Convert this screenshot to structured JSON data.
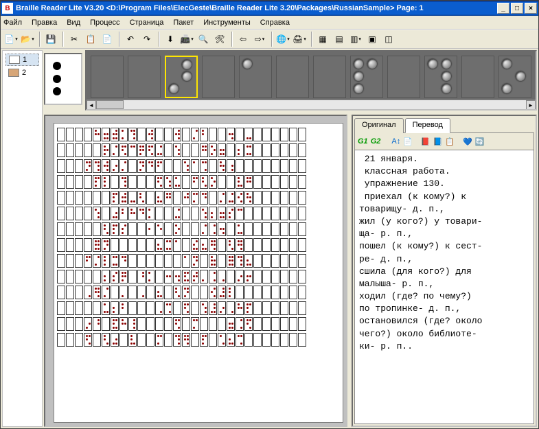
{
  "window": {
    "title": "Braille Reader Lite  V3.20  <D:\\Program Files\\ElecGeste\\Braille Reader Lite 3.20\\Packages\\RussianSample>  Page: 1",
    "min": "_",
    "max": "□",
    "close": "×"
  },
  "menu": [
    "Файл",
    "Правка",
    "Вид",
    "Процесс",
    "Страница",
    "Пакет",
    "Инструменты",
    "Справка"
  ],
  "left": {
    "items": [
      {
        "num": "1",
        "orange": false
      },
      {
        "num": "2",
        "orange": true
      }
    ]
  },
  "tabs": {
    "original": "Оригинал",
    "translation": "Перевод"
  },
  "right_tb": {
    "g1": "G1",
    "g2": "G2"
  },
  "translation_text": " 21 января.\n классная работа.\n упражнение 130.\n приехал (к кому?) к\nтоварищу- д. п.,\nжил (у кого?) у товари-\nща- р. п.,\nпошел (к кому?) к сест-\nре- д. п.,\nсшила (для кого?) для\nмалыша- р. п.,\nходил (где? по чему?)\nпо тропинке- д. п.,\nостановился (где? около\nчего?) около библиоте-\nки- р. п..",
  "strip": {
    "single": [
      1,
      0,
      1,
      0,
      1,
      0
    ],
    "cells": [
      {
        "p": [
          0,
          0,
          0,
          0,
          0,
          0
        ],
        "hl": false
      },
      {
        "p": [
          0,
          0,
          0,
          0,
          0,
          0
        ],
        "hl": false
      },
      {
        "p": [
          0,
          1,
          0,
          1,
          1,
          0
        ],
        "hl": true
      },
      {
        "p": [
          0,
          0,
          0,
          0,
          0,
          0
        ],
        "hl": false
      },
      {
        "p": [
          1,
          0,
          0,
          0,
          0,
          0
        ],
        "hl": false
      },
      {
        "p": [
          0,
          0,
          0,
          0,
          0,
          0
        ],
        "hl": false
      },
      {
        "p": [
          0,
          0,
          0,
          0,
          0,
          0
        ],
        "hl": false
      },
      {
        "p": [
          1,
          1,
          1,
          0,
          1,
          0
        ],
        "hl": false
      },
      {
        "p": [
          0,
          0,
          0,
          0,
          0,
          0
        ],
        "hl": false
      },
      {
        "p": [
          1,
          1,
          0,
          1,
          0,
          1
        ],
        "hl": false
      },
      {
        "p": [
          0,
          0,
          0,
          0,
          0,
          0
        ],
        "hl": false
      },
      {
        "p": [
          1,
          0,
          0,
          1,
          1,
          0
        ],
        "hl": false
      }
    ]
  },
  "braille_rows": 14,
  "braille_cols": 28
}
